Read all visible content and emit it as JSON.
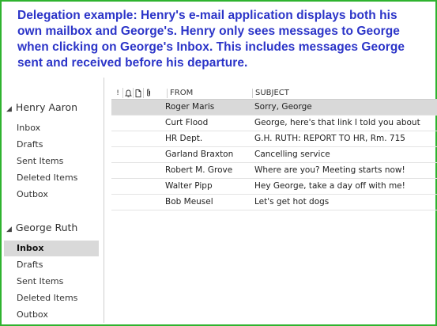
{
  "caption": {
    "lines": [
      "Delegation example:  Henry's e-mail application displays both his",
      "own mailbox and George's.  Henry only sees messages to George",
      "when clicking on George's Inbox.  This includes messages George",
      "sent and received before his departure."
    ]
  },
  "accounts": [
    {
      "name": "Henry Aaron",
      "folders": [
        "Inbox",
        "Drafts",
        "Sent Items",
        "Deleted Items",
        "Outbox"
      ]
    },
    {
      "name": "George Ruth",
      "folders": [
        "Inbox",
        "Drafts",
        "Sent Items",
        "Deleted Items",
        "Outbox"
      ],
      "selected_folder": "Inbox"
    }
  ],
  "message_list": {
    "columns": {
      "importance": "!",
      "from": "FROM",
      "subject": "SUBJECT"
    },
    "rows": [
      {
        "from": "Roger Maris",
        "subject": "Sorry, George",
        "selected": true
      },
      {
        "from": "Curt Flood",
        "subject": "George, here's that link I told you about"
      },
      {
        "from": "HR Dept.",
        "subject": "G.H. RUTH: REPORT TO HR, Rm. 715"
      },
      {
        "from": "Garland Braxton",
        "subject": "Cancelling service"
      },
      {
        "from": "Robert M. Grove",
        "subject": "Where are you? Meeting starts now!"
      },
      {
        "from": "Walter Pipp",
        "subject": "Hey George, take a day off with me!"
      },
      {
        "from": "Bob Meusel",
        "subject": "Let's get hot dogs"
      }
    ]
  },
  "colors": {
    "frame": "#2fb32f",
    "caption": "#2b34c8",
    "selection": "#d9d9d9"
  }
}
